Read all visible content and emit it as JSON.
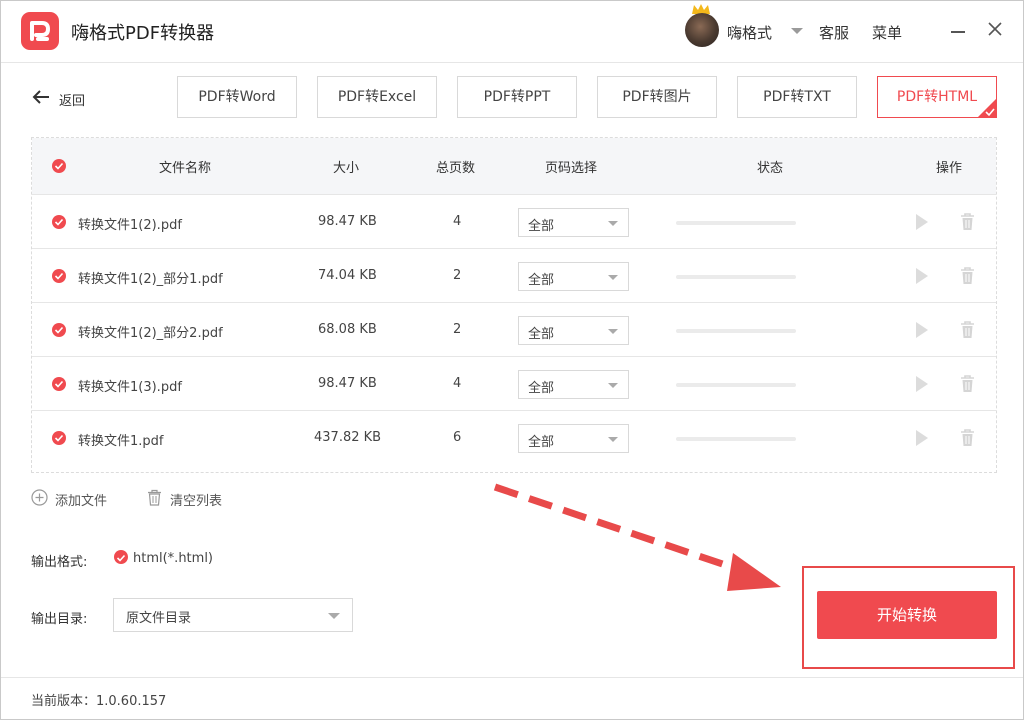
{
  "app": {
    "title": "嗨格式PDF转换器"
  },
  "user": {
    "name": "嗨格式",
    "service_label": "客服",
    "menu_label": "菜单"
  },
  "nav": {
    "back_label": "返回"
  },
  "tabs": [
    {
      "label": "PDF转Word"
    },
    {
      "label": "PDF转Excel"
    },
    {
      "label": "PDF转PPT"
    },
    {
      "label": "PDF转图片"
    },
    {
      "label": "PDF转TXT"
    },
    {
      "label": "PDF转HTML",
      "active": true
    }
  ],
  "table": {
    "headers": {
      "name": "文件名称",
      "size": "大小",
      "pages": "总页数",
      "range": "页码选择",
      "status": "状态",
      "action": "操作"
    },
    "rows": [
      {
        "name": "转换文件1(2).pdf",
        "size": "98.47 KB",
        "pages": "4",
        "range": "全部",
        "progress": 0
      },
      {
        "name": "转换文件1(2)_部分1.pdf",
        "size": "74.04 KB",
        "pages": "2",
        "range": "全部",
        "progress": 0
      },
      {
        "name": "转换文件1(2)_部分2.pdf",
        "size": "68.08 KB",
        "pages": "2",
        "range": "全部",
        "progress": 0
      },
      {
        "name": "转换文件1(3).pdf",
        "size": "98.47 KB",
        "pages": "4",
        "range": "全部",
        "progress": 0
      },
      {
        "name": "转换文件1.pdf",
        "size": "437.82 KB",
        "pages": "6",
        "range": "全部",
        "progress": 0
      }
    ]
  },
  "actions": {
    "add_file": "添加文件",
    "clear_list": "清空列表"
  },
  "output": {
    "format_label": "输出格式:",
    "format_value": "html(*.html)",
    "dir_label": "输出目录:",
    "dir_value": "原文件目录"
  },
  "start_button": "开始转换",
  "footer": {
    "version": "当前版本：1.0.60.157"
  },
  "colors": {
    "accent": "#f04a4f",
    "highlight_frame": "#e84a4a"
  }
}
